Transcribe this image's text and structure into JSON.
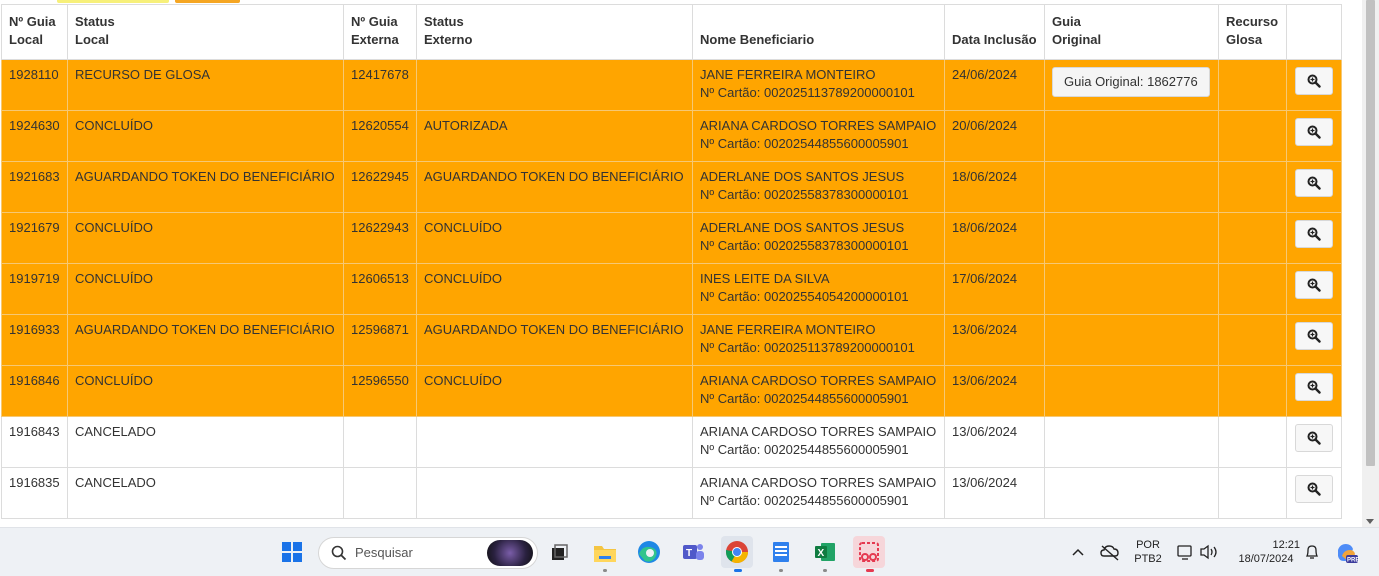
{
  "table": {
    "headers": [
      {
        "line1": "Nº Guia",
        "line2": "Local"
      },
      {
        "line1": "Status",
        "line2": "Local"
      },
      {
        "line1": "Nº Guia",
        "line2": "Externa"
      },
      {
        "line1": "Status",
        "line2": "Externo"
      },
      {
        "line1": "",
        "line2": "Nome Beneficiario"
      },
      {
        "line1": "",
        "line2": "Data Inclusão"
      },
      {
        "line1": "Guia",
        "line2": "Original"
      },
      {
        "line1": "Recurso",
        "line2": "Glosa"
      },
      {
        "line1": "",
        "line2": ""
      }
    ],
    "rows": [
      {
        "guia_local": "1928110",
        "status_local": "RECURSO DE GLOSA",
        "guia_externa": "12417678",
        "status_externo": "",
        "nome": "JANE FERREIRA MONTEIRO",
        "cartao": "Nº Cartão: 00202511378920000010​1",
        "data": "24/06/2024",
        "guia_original": "Guia Original: 1862776",
        "recurso": "",
        "highlight": true
      },
      {
        "guia_local": "1924630",
        "status_local": "CONCLUÍDO",
        "guia_externa": "12620554",
        "status_externo": "AUTORIZADA",
        "nome": "ARIANA CARDOSO TORRES SAMPAIO",
        "cartao": "Nº Cartão: 00202544855600005901",
        "data": "20/06/2024",
        "guia_original": "",
        "recurso": "",
        "highlight": true
      },
      {
        "guia_local": "1921683",
        "status_local": "AGUARDANDO TOKEN DO BENEFICIÁRIO",
        "guia_externa": "12622945",
        "status_externo": "AGUARDANDO TOKEN DO BENEFICIÁRIO",
        "nome": "ADERLANE DOS SANTOS JESUS",
        "cartao": "Nº Cartão: 00202558378300000101",
        "data": "18/06/2024",
        "guia_original": "",
        "recurso": "",
        "highlight": true
      },
      {
        "guia_local": "1921679",
        "status_local": "CONCLUÍDO",
        "guia_externa": "12622943",
        "status_externo": "CONCLUÍDO",
        "nome": "ADERLANE DOS SANTOS JESUS",
        "cartao": "Nº Cartão: 00202558378300000101",
        "data": "18/06/2024",
        "guia_original": "",
        "recurso": "",
        "highlight": true
      },
      {
        "guia_local": "1919719",
        "status_local": "CONCLUÍDO",
        "guia_externa": "12606513",
        "status_externo": "CONCLUÍDO",
        "nome": "INES LEITE DA SILVA",
        "cartao": "Nº Cartão: 00202554054200000101",
        "data": "17/06/2024",
        "guia_original": "",
        "recurso": "",
        "highlight": true
      },
      {
        "guia_local": "1916933",
        "status_local": "AGUARDANDO TOKEN DO BENEFICIÁRIO",
        "guia_externa": "12596871",
        "status_externo": "AGUARDANDO TOKEN DO BENEFICIÁRIO",
        "nome": "JANE FERREIRA MONTEIRO",
        "cartao": "Nº Cartão: 00202511378920000010​1",
        "data": "13/06/2024",
        "guia_original": "",
        "recurso": "",
        "highlight": true
      },
      {
        "guia_local": "1916846",
        "status_local": "CONCLUÍDO",
        "guia_externa": "12596550",
        "status_externo": "CONCLUÍDO",
        "nome": "ARIANA CARDOSO TORRES SAMPAIO",
        "cartao": "Nº Cartão: 00202544855600005901",
        "data": "13/06/2024",
        "guia_original": "",
        "recurso": "",
        "highlight": true
      },
      {
        "guia_local": "1916843",
        "status_local": "CANCELADO",
        "guia_externa": "",
        "status_externo": "",
        "nome": "ARIANA CARDOSO TORRES SAMPAIO",
        "cartao": "Nº Cartão: 00202544855600005901",
        "data": "13/06/2024",
        "guia_original": "",
        "recurso": "",
        "highlight": false
      },
      {
        "guia_local": "1916835",
        "status_local": "CANCELADO",
        "guia_externa": "",
        "status_externo": "",
        "nome": "ARIANA CARDOSO TORRES SAMPAIO",
        "cartao": "Nº Cartão: 00202544855600005901",
        "data": "13/06/2024",
        "guia_original": "",
        "recurso": "",
        "highlight": false
      }
    ]
  },
  "colors": {
    "highlight_row": "#ffa500",
    "normal_row": "#ffffff"
  },
  "taskbar": {
    "search_placeholder": "Pesquisar",
    "apps": [
      "windows-start",
      "task-view",
      "file-explorer",
      "edge",
      "teams",
      "chrome",
      "notepad",
      "excel",
      "snipping-tool"
    ],
    "lang_line1": "POR",
    "lang_line2": "PTB2",
    "time": "12:21",
    "date": "18/07/2024"
  }
}
